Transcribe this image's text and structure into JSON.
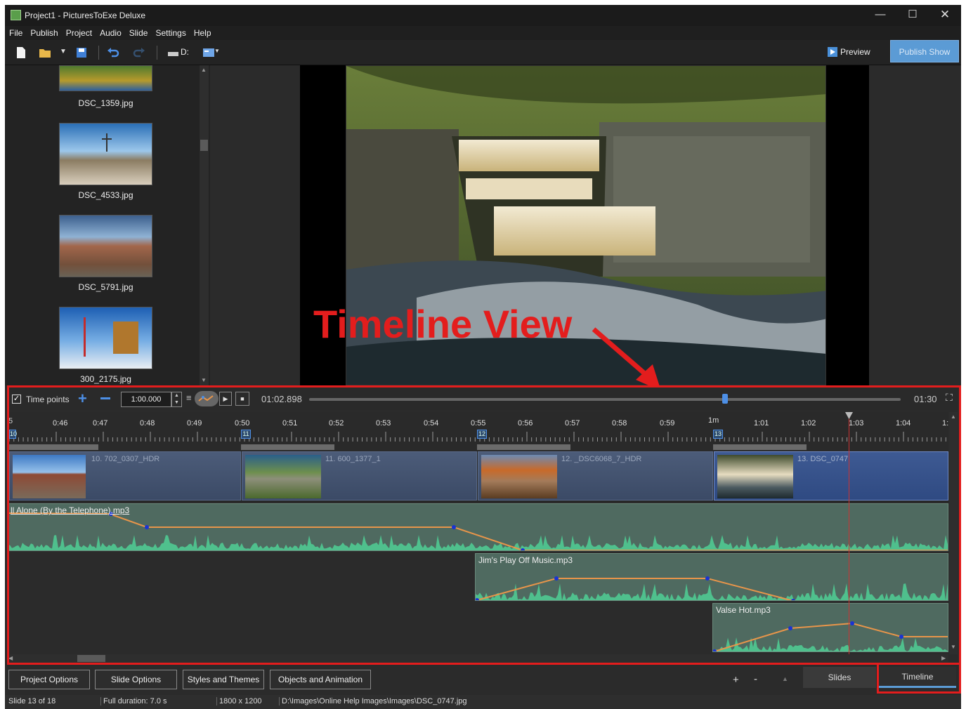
{
  "window": {
    "title": "Project1 - PicturesToExe Deluxe"
  },
  "menu": [
    "File",
    "Publish",
    "Project",
    "Audio",
    "Slide",
    "Settings",
    "Help"
  ],
  "toolbar": {
    "drive_label": "D:",
    "preview_label": "Preview",
    "publish_label": "Publish Show"
  },
  "slides_list": [
    {
      "name": "DSC_1359.jpg"
    },
    {
      "name": "DSC_4533.jpg"
    },
    {
      "name": "DSC_5791.jpg"
    },
    {
      "name": "300_2175.jpg"
    }
  ],
  "annotation": {
    "text": "Timeline View",
    "color": "#e31d1d"
  },
  "timeline": {
    "time_points_label": "Time points",
    "time_points_checked": true,
    "duration_input": "1:00.000",
    "current_time": "01:02.898",
    "total_time": "01:30",
    "scrub_position": 0.703,
    "ruler_labels": [
      "0:46",
      "0:47",
      "0:48",
      "0:49",
      "0:50",
      "0:51",
      "0:52",
      "0:53",
      "0:54",
      "0:55",
      "0:56",
      "0:57",
      "0:58",
      "0:59",
      "1m",
      "1:01",
      "1:02",
      "1:03",
      "1:04"
    ],
    "slide_markers": [
      "10",
      "11",
      "12",
      "13"
    ],
    "slides": [
      {
        "label": "10. 702_0307_HDR"
      },
      {
        "label": "11. 600_1377_1"
      },
      {
        "label": "12. _DSC6068_7_HDR"
      },
      {
        "label": "13. DSC_0747"
      }
    ],
    "audio_tracks": [
      {
        "label": "ll Alone (By the Telephone).mp3"
      },
      {
        "label": "Jim's Play Off Music.mp3"
      },
      {
        "label": "Valse Hot.mp3"
      }
    ]
  },
  "bottom_buttons": {
    "project_options": "Project Options",
    "slide_options": "Slide Options",
    "styles_themes": "Styles and Themes",
    "objects_animation": "Objects and Animation",
    "plus": "+",
    "minus": "-",
    "slides_tab": "Slides",
    "timeline_tab": "Timeline"
  },
  "status": {
    "slide": "Slide 13 of 18",
    "duration": "Full duration: 7.0 s",
    "resolution": "1800 x 1200",
    "path": "D:\\Images\\Online Help Images\\Images\\DSC_0747.jpg"
  },
  "colors": {
    "accent": "#5b9bd5",
    "highlight_box": "#e31d1d",
    "audio_wave": "#4fc08d",
    "volume_line": "#e8954a"
  }
}
